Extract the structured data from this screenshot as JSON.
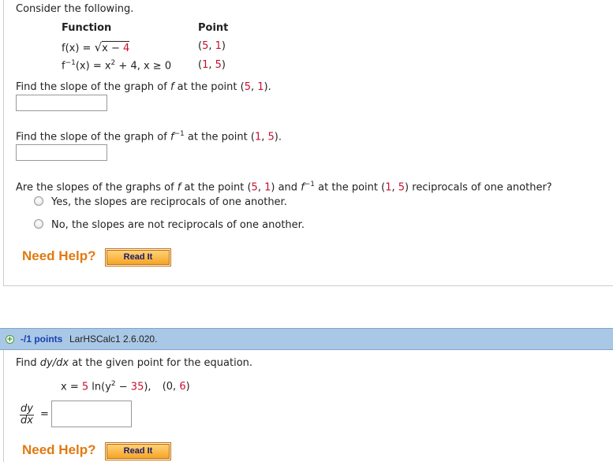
{
  "q1": {
    "intro": "Consider the following.",
    "col_function": "Function",
    "col_point": "Point",
    "row1_func_prefix": "f(x) = ",
    "row1_func_root": "√",
    "row1_func_radicand_x": "x − ",
    "row1_func_radicand_n": "4",
    "row1_point": "(5, 1)",
    "row2_func_a": "f",
    "row2_func_sup": "−1",
    "row2_func_b": "(x) = x",
    "row2_func_sup2": "2",
    "row2_func_c": " + 4, x ≥ 0",
    "row2_point": "(1, 5)",
    "prompt1_a": "Find the slope of the graph of ",
    "prompt1_f": "f",
    "prompt1_b": " at the point ",
    "prompt1_point": "(5, 1).",
    "prompt2_a": "Find the slope of the graph of ",
    "prompt2_f": "f",
    "prompt2_sup": "−1",
    "prompt2_b": " at the point ",
    "prompt2_point": "(1, 5).",
    "prompt3_a": "Are the slopes of the graphs of ",
    "prompt3_f": "f",
    "prompt3_b": " at the point ",
    "prompt3_p1": "(5, 1)",
    "prompt3_c": " and ",
    "prompt3_f2": "f",
    "prompt3_sup": "−1",
    "prompt3_d": " at the point ",
    "prompt3_p2": "(1, 5)",
    "prompt3_e": " reciprocals of one another?",
    "option_yes": "Yes, the slopes are reciprocals of one another.",
    "option_no": "No, the slopes are not reciprocals of one another.",
    "need_help": "Need Help?",
    "read_it": "Read It"
  },
  "q2": {
    "points": "-/1 points",
    "code": "LarHSCalc1 2.6.020.",
    "prompt_a": "Find ",
    "prompt_dydx": "dy/dx",
    "prompt_b": " at the given point for the equation.",
    "eq_a": "x = ",
    "eq_5": "5",
    "eq_b": " ln(y",
    "eq_sup": "2",
    "eq_c": " − ",
    "eq_35": "35",
    "eq_d": "),",
    "eq_point_a": "(0, ",
    "eq_point_6": "6",
    "eq_point_b": ")",
    "frac_num": "dy",
    "frac_den": "dx",
    "equals": "=",
    "need_help": "Need Help?",
    "read_it": "Read It"
  },
  "colors": {
    "accent_red": "#c8102e",
    "need_help_orange": "#e07a10",
    "bar_blue": "#a9c8e6",
    "points_link": "#1a3fb0"
  }
}
